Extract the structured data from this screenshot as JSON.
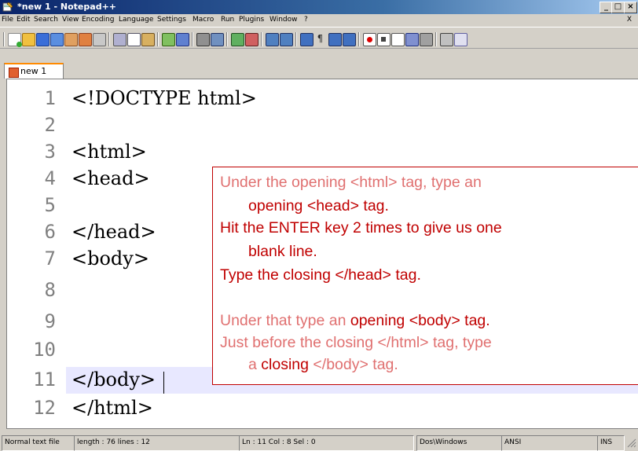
{
  "window": {
    "title": "*new 1 - Notepad++",
    "controls": {
      "minimize": "_",
      "maximize": "□",
      "close": "×"
    }
  },
  "menu": {
    "items": [
      "File",
      "Edit",
      "Search",
      "View",
      "Encoding",
      "Language",
      "Settings",
      "Macro",
      "Run",
      "Plugins",
      "Window",
      "?"
    ],
    "close_doc": "X"
  },
  "tab": {
    "label": "new 1"
  },
  "editor": {
    "line_numbers": [
      "1",
      "2",
      "3",
      "4",
      "5",
      "6",
      "7",
      "8",
      "9",
      "10",
      "11",
      "12"
    ],
    "lines": [
      "<!DOCTYPE html>",
      "",
      "<html>",
      "<head>",
      "",
      "</head>",
      "<body>",
      "",
      "",
      "",
      "</body>",
      "</html>"
    ],
    "current_line": 11
  },
  "tooltip": {
    "l1": "Under the opening <html> tag, type an",
    "l2a": "opening ",
    "l2b": "<head> tag.",
    "l3": "Hit the ENTER key 2 times to give us one",
    "l4": "blank line.",
    "l5a": "Type the ",
    "l5b": "closing ",
    "l5c": "</head> tag.",
    "l6a": "Under that type an ",
    "l6b": "opening ",
    "l6c": "<body> tag.",
    "l7": "Just before the closing </html> tag, type",
    "l8a": "a ",
    "l8b": "closing ",
    "l8c": "</body> tag."
  },
  "status": {
    "type": "Normal text file",
    "length": "length : 76   lines : 12",
    "position": "Ln : 11   Col : 8   Sel : 0",
    "eol": "Dos\\Windows",
    "encoding": "ANSI",
    "mode": "INS"
  },
  "colors": {
    "accent": "#ff8a00",
    "tip_text": "#e07070",
    "tip_emphasis": "#c00000",
    "current_line": "#e8e8ff"
  }
}
